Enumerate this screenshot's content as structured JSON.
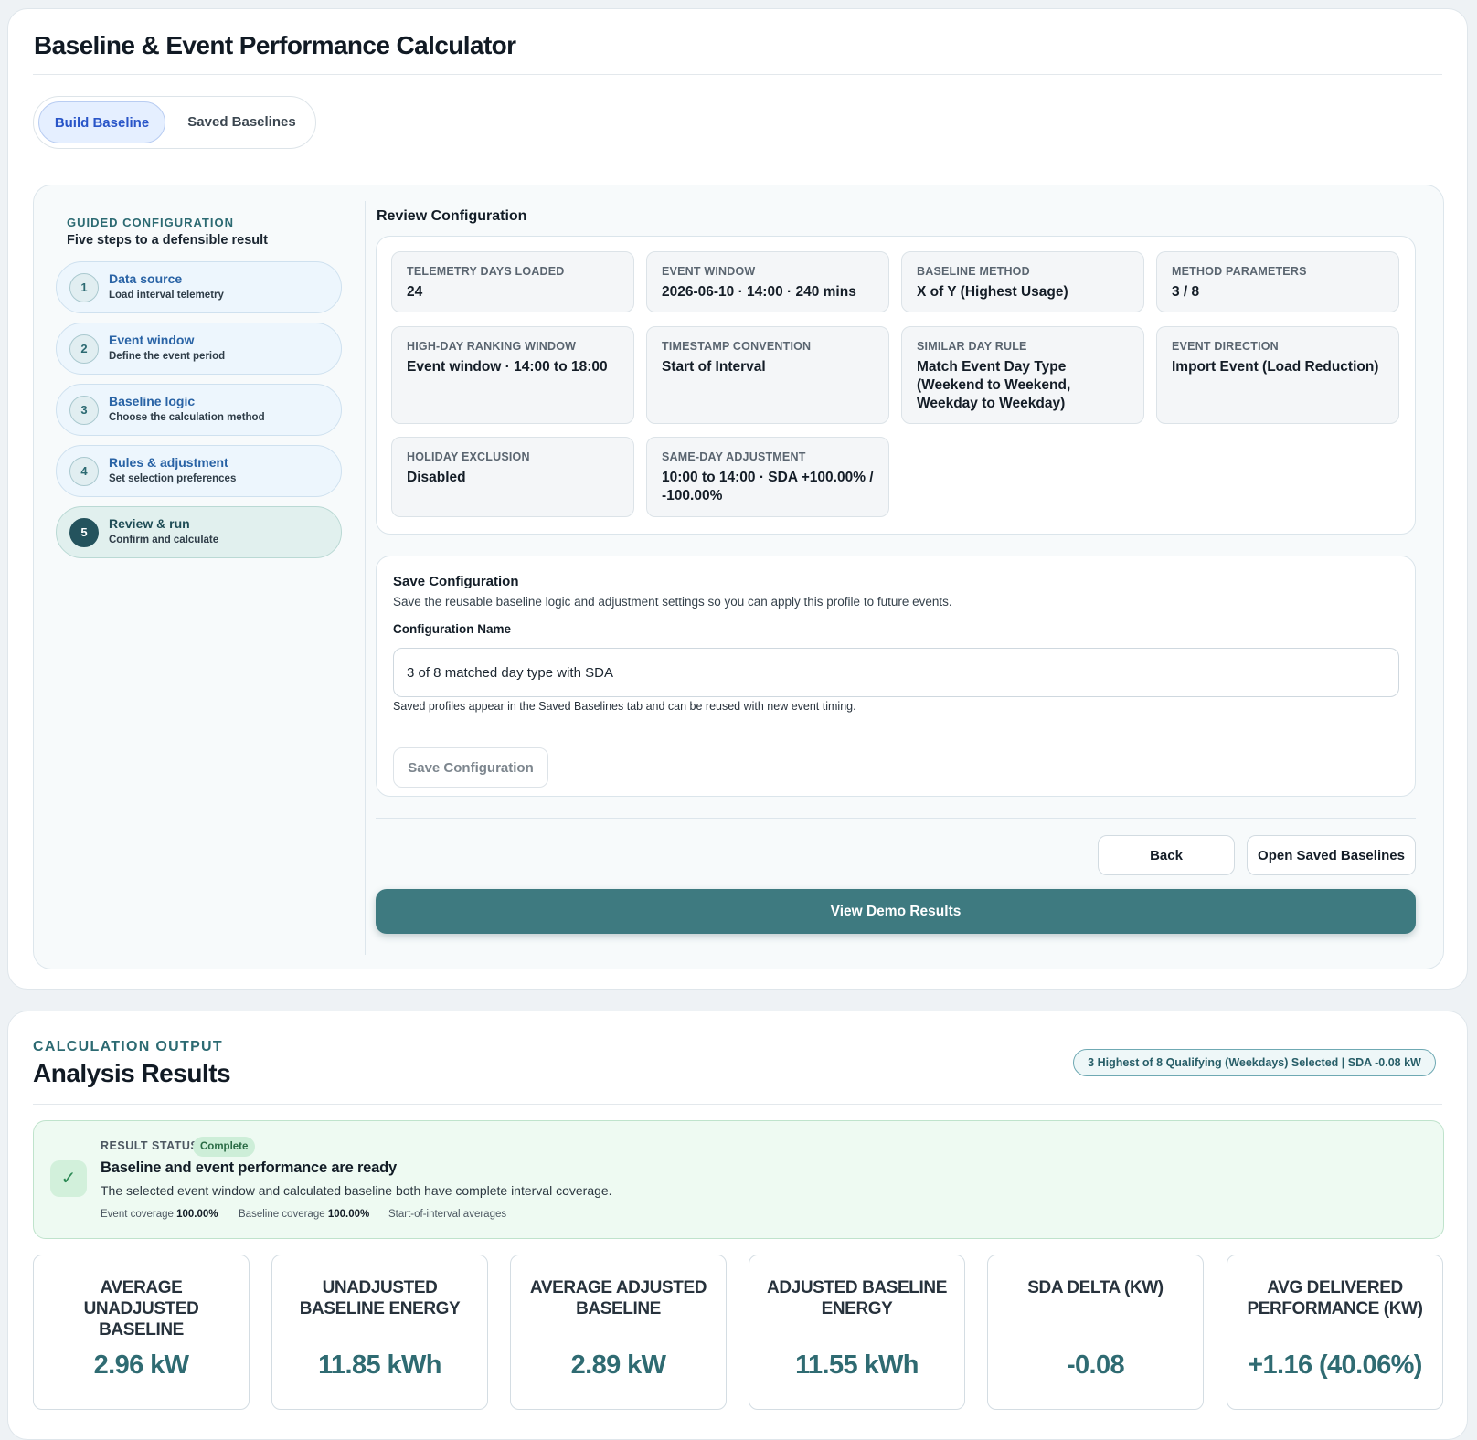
{
  "app": {
    "title": "Baseline & Event Performance Calculator",
    "tabs": [
      "Build Baseline",
      "Saved Baselines"
    ],
    "active_tab": "Build Baseline"
  },
  "guided": {
    "eyebrow": "GUIDED CONFIGURATION",
    "subtitle": "Five steps to a defensible result",
    "steps": [
      {
        "num": "1",
        "title": "Data source",
        "desc": "Load interval telemetry"
      },
      {
        "num": "2",
        "title": "Event window",
        "desc": "Define the event period"
      },
      {
        "num": "3",
        "title": "Baseline logic",
        "desc": "Choose the calculation method"
      },
      {
        "num": "4",
        "title": "Rules & adjustment",
        "desc": "Set selection preferences"
      },
      {
        "num": "5",
        "title": "Review & run",
        "desc": "Confirm and calculate"
      }
    ],
    "active_step": "5"
  },
  "review": {
    "title": "Review Configuration",
    "tiles": [
      {
        "label": "TELEMETRY DAYS LOADED",
        "value": "24"
      },
      {
        "label": "EVENT WINDOW",
        "value": "2026-06-10 · 14:00 · 240 mins"
      },
      {
        "label": "BASELINE METHOD",
        "value": "X of Y (Highest Usage)"
      },
      {
        "label": "METHOD PARAMETERS",
        "value": "3 / 8"
      },
      {
        "label": "HIGH-DAY RANKING WINDOW",
        "value": "Event window · 14:00 to 18:00"
      },
      {
        "label": "TIMESTAMP CONVENTION",
        "value": "Start of Interval"
      },
      {
        "label": "SIMILAR DAY RULE",
        "value": "Match Event Day Type (Weekend to Weekend, Weekday to Weekday)"
      },
      {
        "label": "EVENT DIRECTION",
        "value": "Import Event (Load Reduction)"
      },
      {
        "label": "HOLIDAY EXCLUSION",
        "value": "Disabled"
      },
      {
        "label": "SAME-DAY ADJUSTMENT",
        "value": "10:00 to 14:00 · SDA +100.00% / -100.00%"
      }
    ]
  },
  "save": {
    "title": "Save Configuration",
    "description": "Save the reusable baseline logic and adjustment settings so you can apply this profile to future events.",
    "name_label": "Configuration Name",
    "name_value": "3 of 8 matched day type with SDA",
    "hint": "Saved profiles appear in the Saved Baselines tab and can be reused with new event timing.",
    "button": "Save Configuration"
  },
  "actions": {
    "back": "Back",
    "open_saved": "Open Saved Baselines",
    "view_results": "View Demo Results"
  },
  "output": {
    "eyebrow": "CALCULATION OUTPUT",
    "title": "Analysis Results",
    "badge": "3 Highest of 8 Qualifying (Weekdays) Selected | SDA -0.08 kW",
    "status": {
      "eyebrow": "RESULT STATUS",
      "pill": "Complete",
      "heading": "Baseline and event performance are ready",
      "description": "The selected event window and calculated baseline both have complete interval coverage.",
      "event_coverage_label": "Event coverage",
      "event_coverage_value": "100.00%",
      "baseline_coverage_label": "Baseline coverage",
      "baseline_coverage_value": "100.00%",
      "averages_note": "Start-of-interval averages"
    },
    "metrics": [
      {
        "label": "AVERAGE UNADJUSTED BASELINE",
        "value": "2.96 kW"
      },
      {
        "label": "UNADJUSTED BASELINE ENERGY",
        "value": "11.85 kWh"
      },
      {
        "label": "AVERAGE ADJUSTED BASELINE",
        "value": "2.89 kW"
      },
      {
        "label": "ADJUSTED BASELINE ENERGY",
        "value": "11.55 kWh"
      },
      {
        "label": "SDA DELTA (KW)",
        "value": "-0.08"
      },
      {
        "label": "AVG DELIVERED PERFORMANCE (KW)",
        "value": "+1.16 (40.06%)"
      }
    ]
  },
  "colors": {
    "accent": "#3e7a80",
    "tab_active": "#2955c8",
    "success": "#2d8a55",
    "metric_value": "#2f6b72"
  }
}
